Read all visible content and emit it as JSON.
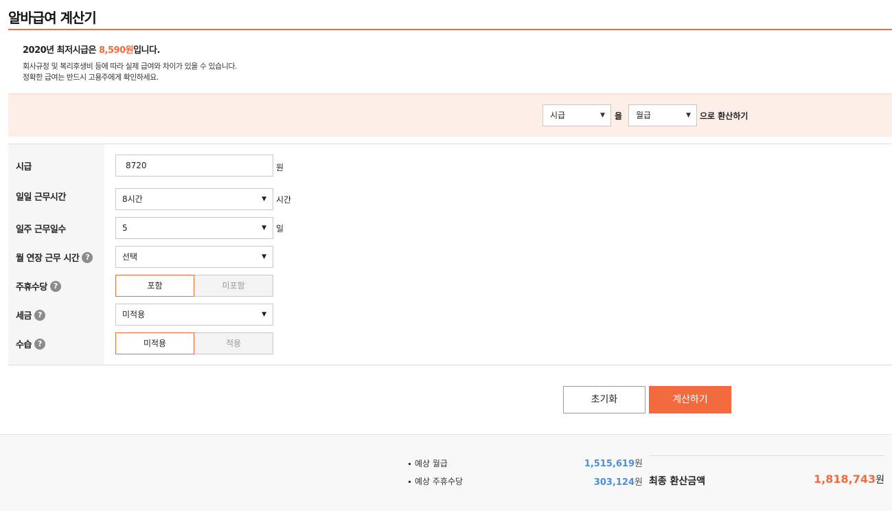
{
  "page": {
    "title": "알바급여 계산기"
  },
  "notice": {
    "main_prefix": "2020년 최저시급은 ",
    "main_wage": "8,590원",
    "main_suffix": "입니다.",
    "line1": "회사규정 및 복리후생비 등에 따라 실제 급여와 차이가 있을 수 있습니다.",
    "line2": "정확한 급여는 반드시 고용주에게 확인하세요."
  },
  "convert": {
    "from": "시급",
    "particle1": "을",
    "to": "월급",
    "suffix": "으로 환산하기"
  },
  "form": {
    "hourly": {
      "label": "시급",
      "value": "8720",
      "unit": "원"
    },
    "daily_hours": {
      "label": "일일 근무시간",
      "value": "8시간",
      "unit": "시간"
    },
    "weekly_days": {
      "label": "일주 근무일수",
      "value": "5",
      "unit": "일"
    },
    "overtime": {
      "label": "월 연장 근무 시간",
      "value": "선택"
    },
    "weekly_allowance": {
      "label": "주휴수당",
      "on": "포함",
      "off": "미포함"
    },
    "tax": {
      "label": "세금",
      "value": "미적용"
    },
    "probation": {
      "label": "수습",
      "on": "미적용",
      "off": "적용"
    }
  },
  "buttons": {
    "reset": "초기화",
    "calculate": "계산하기"
  },
  "result": {
    "monthly_label": "예상 월급",
    "monthly_value": "1,515,619",
    "allowance_label": "예상 주휴수당",
    "allowance_value": "303,124",
    "currency": "원",
    "final_label": "최종 환산금액",
    "final_value": "1,818,743"
  },
  "icons": {
    "help": "?",
    "arrow": "▼"
  },
  "colors": {
    "accent": "#f26a3d",
    "result_number": "#4a90d9"
  }
}
